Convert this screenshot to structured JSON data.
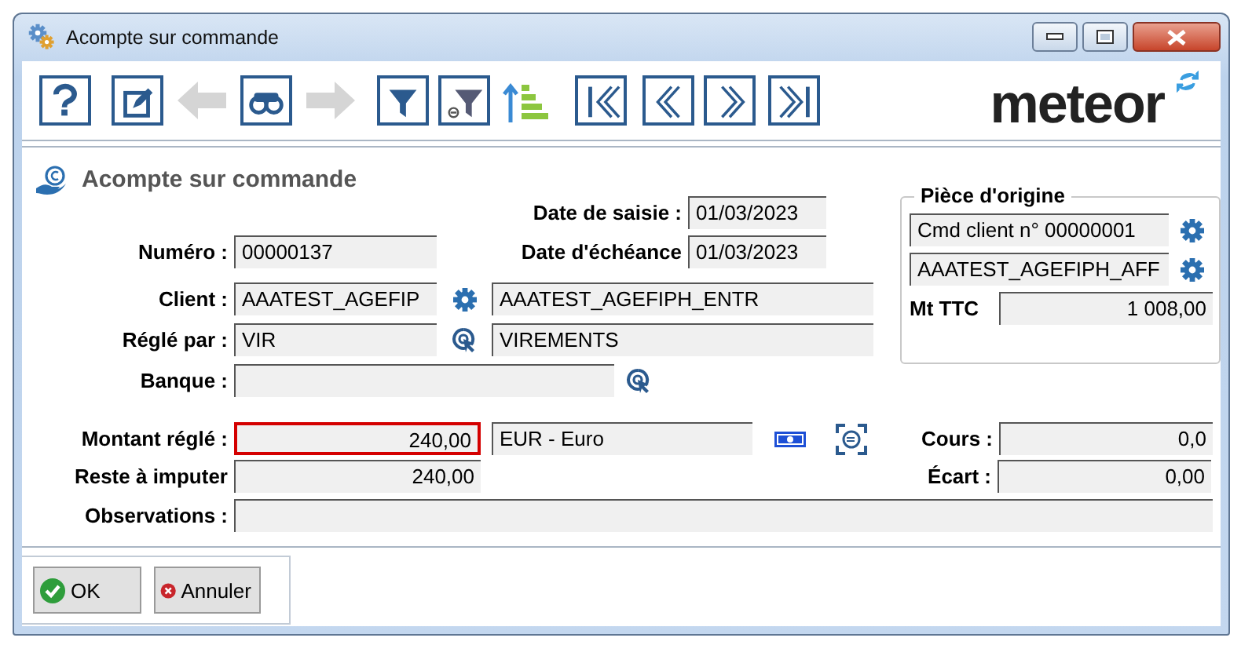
{
  "window": {
    "title": "Acompte sur commande"
  },
  "toolbar": {
    "buttons": [
      {
        "kind": "help",
        "disabled": false
      },
      {
        "kind": "edit",
        "disabled": false
      },
      {
        "kind": "previous",
        "disabled": true
      },
      {
        "kind": "search",
        "disabled": false
      },
      {
        "kind": "next",
        "disabled": true
      },
      {
        "kind": "filter",
        "disabled": false
      },
      {
        "kind": "clear-filter",
        "disabled": false
      },
      {
        "kind": "sort",
        "disabled": false
      },
      {
        "kind": "first",
        "disabled": false
      },
      {
        "kind": "back",
        "disabled": false
      },
      {
        "kind": "forward",
        "disabled": false
      },
      {
        "kind": "last",
        "disabled": false
      }
    ],
    "logo": "meteor"
  },
  "form": {
    "heading": "Acompte sur commande",
    "date_saisie": {
      "label": "Date de saisie :",
      "value": "01/03/2023"
    },
    "numero": {
      "label": "Numéro :",
      "value": "00000137"
    },
    "date_echeance": {
      "label": "Date d'échéance",
      "value": "01/03/2023"
    },
    "client": {
      "label": "Client :",
      "code": "AAATEST_AGEFIP",
      "name": "AAATEST_AGEFIPH_ENTR"
    },
    "regle_par": {
      "label": "Réglé par :",
      "code": "VIR",
      "name": "VIREMENTS"
    },
    "banque": {
      "label": "Banque :"
    },
    "piece_origine": {
      "title": "Pièce d'origine",
      "commande": "Cmd client n° 00000001",
      "client": "AAATEST_AGEFIPH_AFF",
      "mt_ttc": {
        "label": "Mt TTC",
        "value": "1 008,00"
      }
    },
    "montant_regle": {
      "label": "Montant réglé :",
      "value": "240,00",
      "focused": true,
      "currency": "EUR - Euro"
    },
    "cours": {
      "label": "Cours :",
      "value": "0,0"
    },
    "reste": {
      "label": "Reste à imputer",
      "value": "240,00"
    },
    "ecart": {
      "label": "Écart :",
      "value": "0,00"
    },
    "observations": {
      "label": "Observations :"
    }
  },
  "buttons": [
    {
      "kind": "ok",
      "label": "OK"
    },
    {
      "kind": "cancel",
      "label": "Annuler"
    }
  ]
}
